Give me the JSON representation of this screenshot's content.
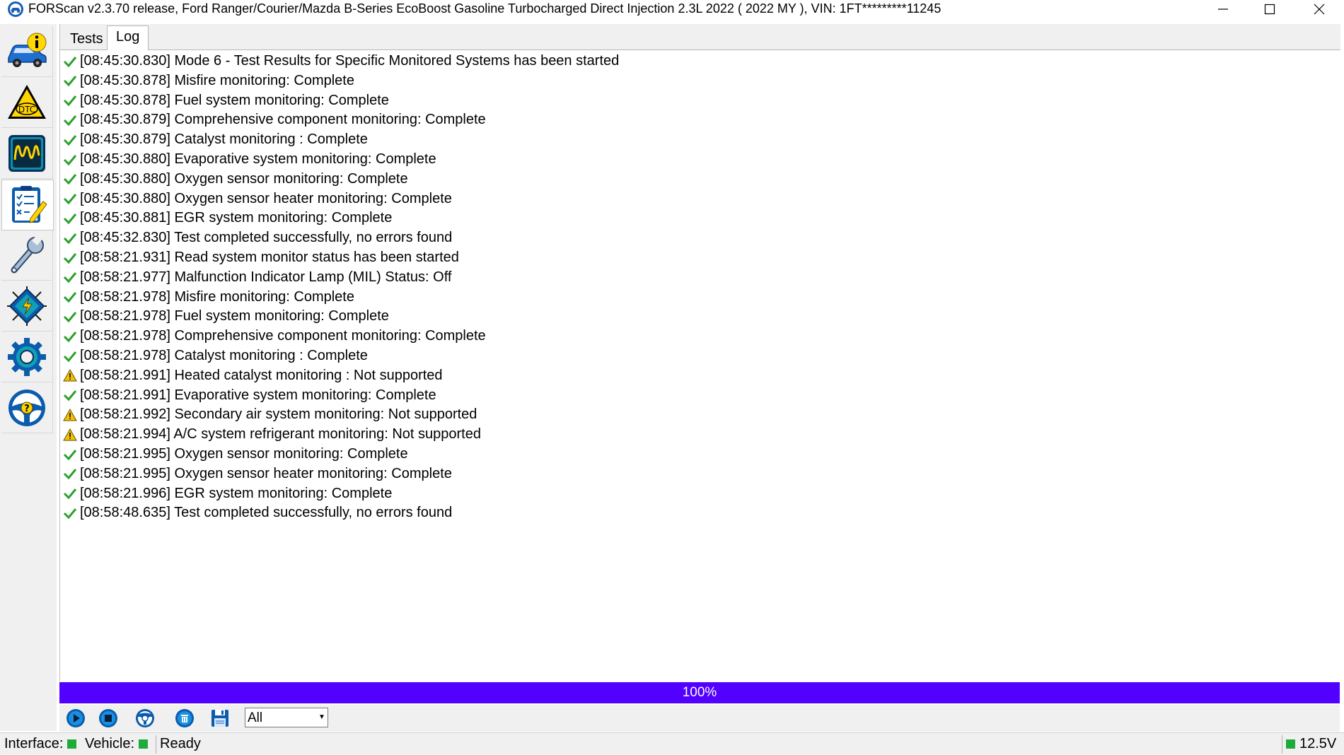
{
  "window": {
    "title": "FORScan v2.3.70 release, Ford Ranger/Courier/Mazda B-Series EcoBoost Gasoline Turbocharged Direct Injection 2.3L 2022 ( 2022 MY ), VIN: 1FT*********11245"
  },
  "sidebar": {
    "items": [
      {
        "name": "vehicle-info",
        "icon": "car-info-icon"
      },
      {
        "name": "dtc",
        "icon": "dtc-warning-icon",
        "label": "DTC"
      },
      {
        "name": "oscilloscope",
        "icon": "waveform-icon"
      },
      {
        "name": "tests",
        "icon": "checklist-icon",
        "active": true
      },
      {
        "name": "service",
        "icon": "wrench-icon"
      },
      {
        "name": "configuration",
        "icon": "chip-icon"
      },
      {
        "name": "settings",
        "icon": "gear-icon"
      },
      {
        "name": "help",
        "icon": "help-wheel-icon"
      }
    ]
  },
  "tabs": {
    "tests": "Tests",
    "log": "Log",
    "active": "log"
  },
  "log": [
    {
      "status": "ok",
      "text": "[08:45:30.830] Mode 6 - Test Results for Specific Monitored Systems has been started"
    },
    {
      "status": "ok",
      "text": "[08:45:30.878] Misfire monitoring: Complete"
    },
    {
      "status": "ok",
      "text": "[08:45:30.878] Fuel system monitoring: Complete"
    },
    {
      "status": "ok",
      "text": "[08:45:30.879] Comprehensive component monitoring: Complete"
    },
    {
      "status": "ok",
      "text": "[08:45:30.879] Catalyst monitoring : Complete"
    },
    {
      "status": "ok",
      "text": "[08:45:30.880] Evaporative system monitoring: Complete"
    },
    {
      "status": "ok",
      "text": "[08:45:30.880] Oxygen sensor monitoring: Complete"
    },
    {
      "status": "ok",
      "text": "[08:45:30.880] Oxygen sensor heater monitoring: Complete"
    },
    {
      "status": "ok",
      "text": "[08:45:30.881] EGR system monitoring: Complete"
    },
    {
      "status": "ok",
      "text": "[08:45:32.830] Test completed successfully, no errors found"
    },
    {
      "status": "ok",
      "text": "[08:58:21.931] Read system monitor status has been started"
    },
    {
      "status": "ok",
      "text": "[08:58:21.977] Malfunction Indicator Lamp (MIL) Status: Off"
    },
    {
      "status": "ok",
      "text": "[08:58:21.978] Misfire monitoring: Complete"
    },
    {
      "status": "ok",
      "text": "[08:58:21.978] Fuel system monitoring: Complete"
    },
    {
      "status": "ok",
      "text": "[08:58:21.978] Comprehensive component monitoring: Complete"
    },
    {
      "status": "ok",
      "text": "[08:58:21.978] Catalyst monitoring : Complete"
    },
    {
      "status": "warn",
      "text": "[08:58:21.991] Heated catalyst monitoring : Not supported"
    },
    {
      "status": "ok",
      "text": "[08:58:21.991] Evaporative system monitoring: Complete"
    },
    {
      "status": "warn",
      "text": "[08:58:21.992] Secondary air system monitoring: Not supported"
    },
    {
      "status": "warn",
      "text": "[08:58:21.994] A/C system refrigerant monitoring: Not supported"
    },
    {
      "status": "ok",
      "text": "[08:58:21.995] Oxygen sensor monitoring: Complete"
    },
    {
      "status": "ok",
      "text": "[08:58:21.995] Oxygen sensor heater monitoring: Complete"
    },
    {
      "status": "ok",
      "text": "[08:58:21.996] EGR system monitoring: Complete"
    },
    {
      "status": "ok",
      "text": "[08:58:48.635] Test completed successfully, no errors found"
    }
  ],
  "progress": {
    "value": 1.0,
    "label": "100%",
    "color": "#5200ff"
  },
  "toolbar": {
    "buttons": [
      {
        "name": "start",
        "icon": "play-icon"
      },
      {
        "name": "stop",
        "icon": "stop-icon"
      },
      {
        "name": "help",
        "icon": "lifebuoy-icon"
      },
      {
        "name": "clear",
        "icon": "trash-icon"
      },
      {
        "name": "save",
        "icon": "floppy-disk-icon"
      }
    ],
    "filter": {
      "selected": "All"
    }
  },
  "status": {
    "interface_label": "Interface:",
    "vehicle_label": "Vehicle:",
    "state": "Ready",
    "voltage": "12.5V",
    "led_color": "#1faa3c"
  },
  "colors": {
    "ok": "#2ca02c",
    "warn": "#f2c200"
  }
}
